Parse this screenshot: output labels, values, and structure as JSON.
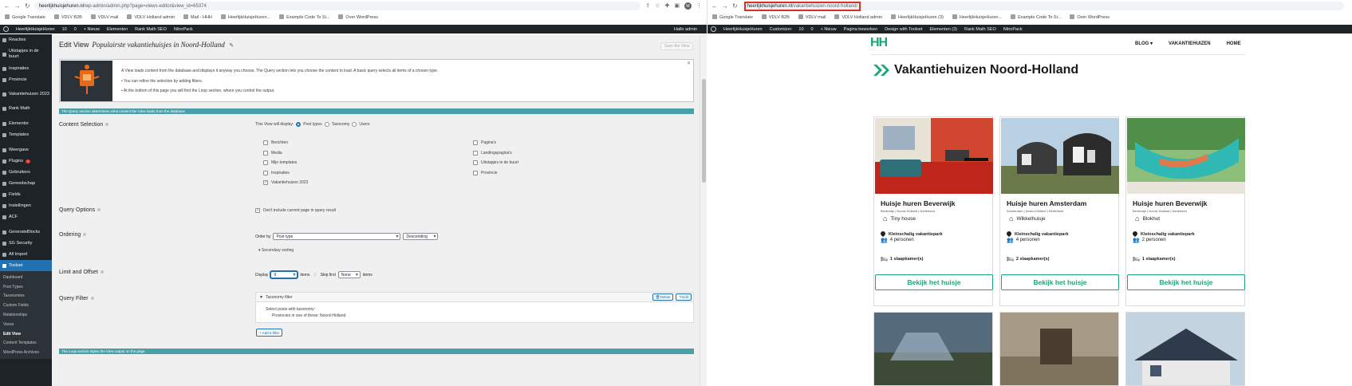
{
  "left_browser": {
    "url_host": "heerlijkhuisjehuren.nl",
    "url_path": "/wp-admin/admin.php?page=views-editor&view_id=65374",
    "bookmarks": [
      "Google Translate",
      "VDLV B2B",
      "VDLV mail",
      "VDLV Holland admin",
      "Mail - HHH",
      "HeerlijkHuisjeHuren...",
      "Example Code To Si...",
      "Over WordPress"
    ],
    "avatar": "M"
  },
  "right_browser": {
    "url_host": "heerlijkhuisjehuren.nl",
    "url_path": "/vakantiehuizen-noord-holland/",
    "bookmarks": [
      "Google Translate",
      "VDLV B2B",
      "VDLV mail",
      "VDLV Holland admin",
      "HeerlijkHuisjeHuren (3)",
      "HeerlijkHuisjeHuren...",
      "Example Code To Si...",
      "Over WordPress"
    ]
  },
  "adminbar_left": {
    "items": [
      "HeerlijkHuisjeHuren",
      "10",
      "0",
      "+ Nieuw",
      "Elementen",
      "Rank Math SEO",
      "NitroPack"
    ],
    "greeting": "Hallo admin"
  },
  "adminbar_right": {
    "items": [
      "HeerlijkHuisjeHuren",
      "Customizer",
      "10",
      "0",
      "+ Nieuw",
      "Pagina bewerken",
      "Design with Toolset",
      "Elementen (3)",
      "Rank Math SEO",
      "NitroPack"
    ]
  },
  "sidebar": {
    "items": [
      "Reacties",
      "Uitstapjes in de buurt",
      "Inspiraties",
      "Provincie",
      "Vakantiehuizen 2023",
      "Rank Math",
      "Elementor",
      "Templates",
      "Weergave",
      "Plugins",
      "Gebruikers",
      "Gereedschap",
      "Fields",
      "Instellingen",
      "ACF",
      "GenerateBlocks",
      "SG Security",
      "All Import",
      "Toolset"
    ],
    "plugins_badge": "7",
    "submenu": [
      "Dashboard",
      "Post Types",
      "Taxonomies",
      "Custom Fields",
      "Relationships",
      "Views",
      "Edit View",
      "Content Templates",
      "WordPress Archives"
    ]
  },
  "editor": {
    "heading": "Edit View",
    "view_title": "Populairste vakantiehuisjes in Noord-Holland",
    "save_label": "Save the View",
    "notice_lines": [
      "A View loads content from the database and displays it anyway you choose. The Query section lets you choose the content to load. A basic query selects all items of a chosen type.",
      "You can refine the selection by adding filters.",
      "At the bottom of this page you will find the Loop section, where you control the output."
    ],
    "query_bar": "The Query section determines what content the View loads from the database",
    "loop_bar": "The Loop section styles the View output on the page.",
    "content_selection": {
      "label": "Content Selection",
      "display_prompt": "This View will display:",
      "modes": [
        "Post types",
        "Taxonomy",
        "Users"
      ],
      "col1": [
        "Berichten",
        "Media",
        "Mijn templates",
        "Inspiraties",
        "Vakantiehuizen 2023"
      ],
      "col2": [
        "Pagina's",
        "Landingspagina's",
        "Uitstapjes in de buurt",
        "Provincie"
      ],
      "checked": "Vakantiehuizen 2023"
    },
    "query_options": {
      "label": "Query Options",
      "option": "Don't include current page in query result"
    },
    "ordering": {
      "label": "Ordering",
      "order_by": "Order by",
      "field": "Post type",
      "direction": "Descending",
      "secondary": "Secondary sorting"
    },
    "limit": {
      "label": "Limit and Offset",
      "display": "Display",
      "display_value": "9",
      "items": "items",
      "skip": "Skip first",
      "skip_value": "None",
      "items2": "items"
    },
    "query_filter": {
      "label": "Query Filter",
      "box_title": "Taxonomy filter",
      "delete": "Delete",
      "edit": "Edit",
      "line1": "Select posts with taxonomy:",
      "line2": "Provincies in one of these: Noord-Holland",
      "add": "+ Add a filter"
    }
  },
  "site": {
    "logo": "HH",
    "nav": [
      "BLOG",
      "VAKANTIEHUIZEN",
      "HOME"
    ],
    "page_title": "Vakantiehuizen Noord-Holland",
    "cards": [
      {
        "name": "Huisje huren Beverwijk",
        "location": "Beverwijk | Noord-Holland | Nederland",
        "type": "Tiny house",
        "park": "Kleinschalig vakantiepark",
        "persons": "4 personen",
        "bedrooms": "1 slaapkamer(s)",
        "cta": "Bekijk het huisje"
      },
      {
        "name": "Huisje huren Amsterdam",
        "location": "Amsterdam | Noord-Holland | Nederland",
        "type": "Wikkelhuisje",
        "park": "Kleinschalig vakantiepark",
        "persons": "4 personen",
        "bedrooms": "2 slaapkamer(s)",
        "cta": "Bekijk het huisje"
      },
      {
        "name": "Huisje huren Beverwijk",
        "location": "Beverwijk | Noord-Holland | Nederland",
        "type": "Blokhut",
        "park": "Kleinschalig vakantiepark",
        "persons": "2 personen",
        "bedrooms": "1 slaapkamer(s)",
        "cta": "Bekijk het huisje"
      }
    ]
  },
  "colors": {
    "wp_dark": "#1d2327",
    "wp_blue": "#2271b1",
    "section_bar": "#4aa0a8",
    "brand_green": "#1aa67a",
    "highlight_red": "#d93025"
  }
}
